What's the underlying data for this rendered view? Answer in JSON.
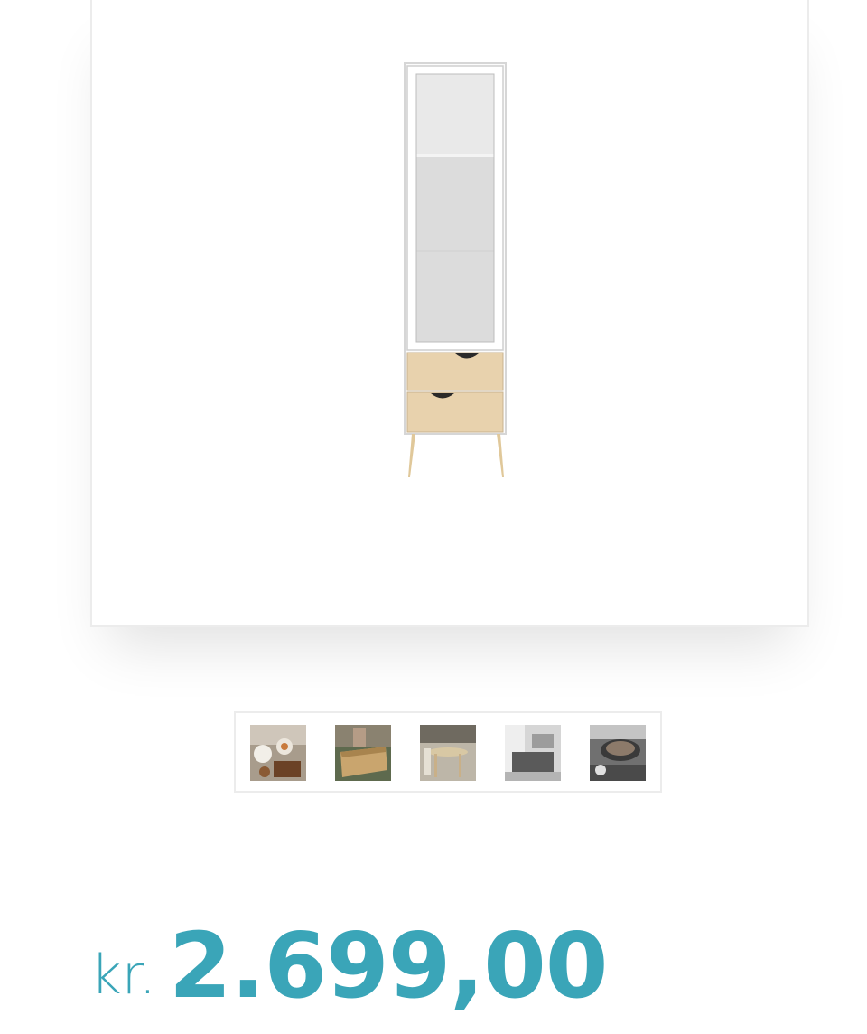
{
  "product": {
    "main_image_alt": "cabinet-product-image",
    "thumbnails": [
      {
        "name": "thumbnail-1",
        "subject": "tableware"
      },
      {
        "name": "thumbnail-2",
        "subject": "wooden-drawer"
      },
      {
        "name": "thumbnail-3",
        "subject": "side-table"
      },
      {
        "name": "thumbnail-4",
        "subject": "living-room"
      },
      {
        "name": "thumbnail-5",
        "subject": "kitchenware"
      }
    ],
    "price": {
      "currency": "kr.",
      "amount": "2.699,00"
    }
  },
  "colors": {
    "accent": "#3aa5b8",
    "frame_border": "#ececec",
    "oak": "#e8d2ad"
  }
}
